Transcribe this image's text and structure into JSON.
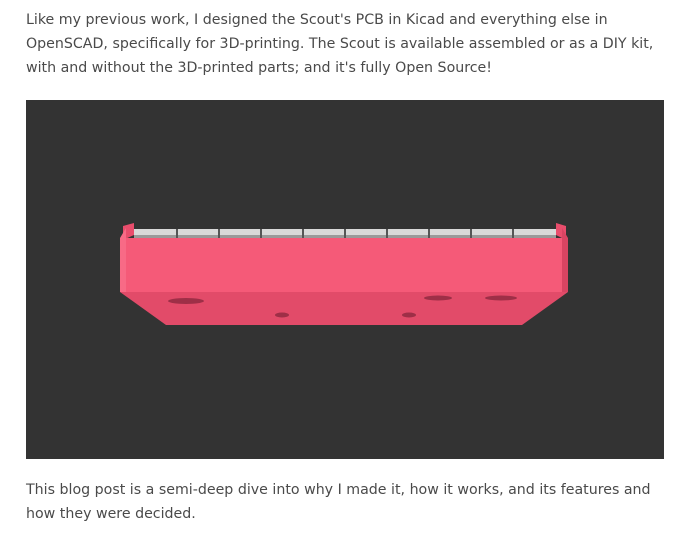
{
  "article": {
    "intro_text": "Like my previous work, I designed the Scout's PCB in Kicad and everything else in OpenSCAD, specifically for 3D-printing. The Scout is available assembled or as a DIY kit, with and without the 3D-printed parts; and it's fully Open Source!",
    "figure": {
      "background": "#333333",
      "case_color": "#f55a78"
    },
    "closing_text": "This blog post is a semi-deep dive into why I made it, how it works, and its features and how they were decided."
  }
}
